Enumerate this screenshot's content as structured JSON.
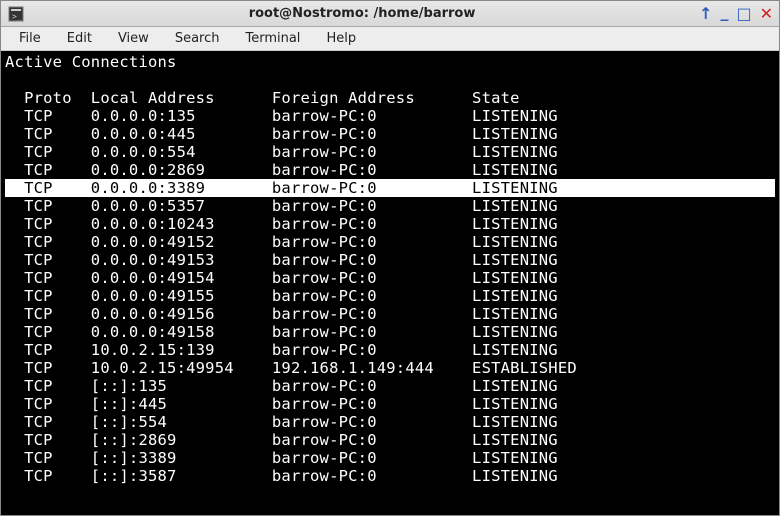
{
  "window": {
    "title": "root@Nostromo: /home/barrow"
  },
  "menubar": {
    "items": [
      "File",
      "Edit",
      "View",
      "Search",
      "Terminal",
      "Help"
    ]
  },
  "terminal": {
    "heading": "Active Connections",
    "columns": {
      "proto": "Proto",
      "local": "Local Address",
      "foreign": "Foreign Address",
      "state": "State"
    },
    "rows": [
      {
        "proto": "TCP",
        "local": "0.0.0.0:135",
        "foreign": "barrow-PC:0",
        "state": "LISTENING",
        "highlight": false
      },
      {
        "proto": "TCP",
        "local": "0.0.0.0:445",
        "foreign": "barrow-PC:0",
        "state": "LISTENING",
        "highlight": false
      },
      {
        "proto": "TCP",
        "local": "0.0.0.0:554",
        "foreign": "barrow-PC:0",
        "state": "LISTENING",
        "highlight": false
      },
      {
        "proto": "TCP",
        "local": "0.0.0.0:2869",
        "foreign": "barrow-PC:0",
        "state": "LISTENING",
        "highlight": false
      },
      {
        "proto": "TCP",
        "local": "0.0.0.0:3389",
        "foreign": "barrow-PC:0",
        "state": "LISTENING",
        "highlight": true
      },
      {
        "proto": "TCP",
        "local": "0.0.0.0:5357",
        "foreign": "barrow-PC:0",
        "state": "LISTENING",
        "highlight": false
      },
      {
        "proto": "TCP",
        "local": "0.0.0.0:10243",
        "foreign": "barrow-PC:0",
        "state": "LISTENING",
        "highlight": false
      },
      {
        "proto": "TCP",
        "local": "0.0.0.0:49152",
        "foreign": "barrow-PC:0",
        "state": "LISTENING",
        "highlight": false
      },
      {
        "proto": "TCP",
        "local": "0.0.0.0:49153",
        "foreign": "barrow-PC:0",
        "state": "LISTENING",
        "highlight": false
      },
      {
        "proto": "TCP",
        "local": "0.0.0.0:49154",
        "foreign": "barrow-PC:0",
        "state": "LISTENING",
        "highlight": false
      },
      {
        "proto": "TCP",
        "local": "0.0.0.0:49155",
        "foreign": "barrow-PC:0",
        "state": "LISTENING",
        "highlight": false
      },
      {
        "proto": "TCP",
        "local": "0.0.0.0:49156",
        "foreign": "barrow-PC:0",
        "state": "LISTENING",
        "highlight": false
      },
      {
        "proto": "TCP",
        "local": "0.0.0.0:49158",
        "foreign": "barrow-PC:0",
        "state": "LISTENING",
        "highlight": false
      },
      {
        "proto": "TCP",
        "local": "10.0.2.15:139",
        "foreign": "barrow-PC:0",
        "state": "LISTENING",
        "highlight": false
      },
      {
        "proto": "TCP",
        "local": "10.0.2.15:49954",
        "foreign": "192.168.1.149:444",
        "state": "ESTABLISHED",
        "highlight": false
      },
      {
        "proto": "TCP",
        "local": "[::]:135",
        "foreign": "barrow-PC:0",
        "state": "LISTENING",
        "highlight": false
      },
      {
        "proto": "TCP",
        "local": "[::]:445",
        "foreign": "barrow-PC:0",
        "state": "LISTENING",
        "highlight": false
      },
      {
        "proto": "TCP",
        "local": "[::]:554",
        "foreign": "barrow-PC:0",
        "state": "LISTENING",
        "highlight": false
      },
      {
        "proto": "TCP",
        "local": "[::]:2869",
        "foreign": "barrow-PC:0",
        "state": "LISTENING",
        "highlight": false
      },
      {
        "proto": "TCP",
        "local": "[::]:3389",
        "foreign": "barrow-PC:0",
        "state": "LISTENING",
        "highlight": false
      },
      {
        "proto": "TCP",
        "local": "[::]:3587",
        "foreign": "barrow-PC:0",
        "state": "LISTENING",
        "highlight": false
      }
    ]
  }
}
